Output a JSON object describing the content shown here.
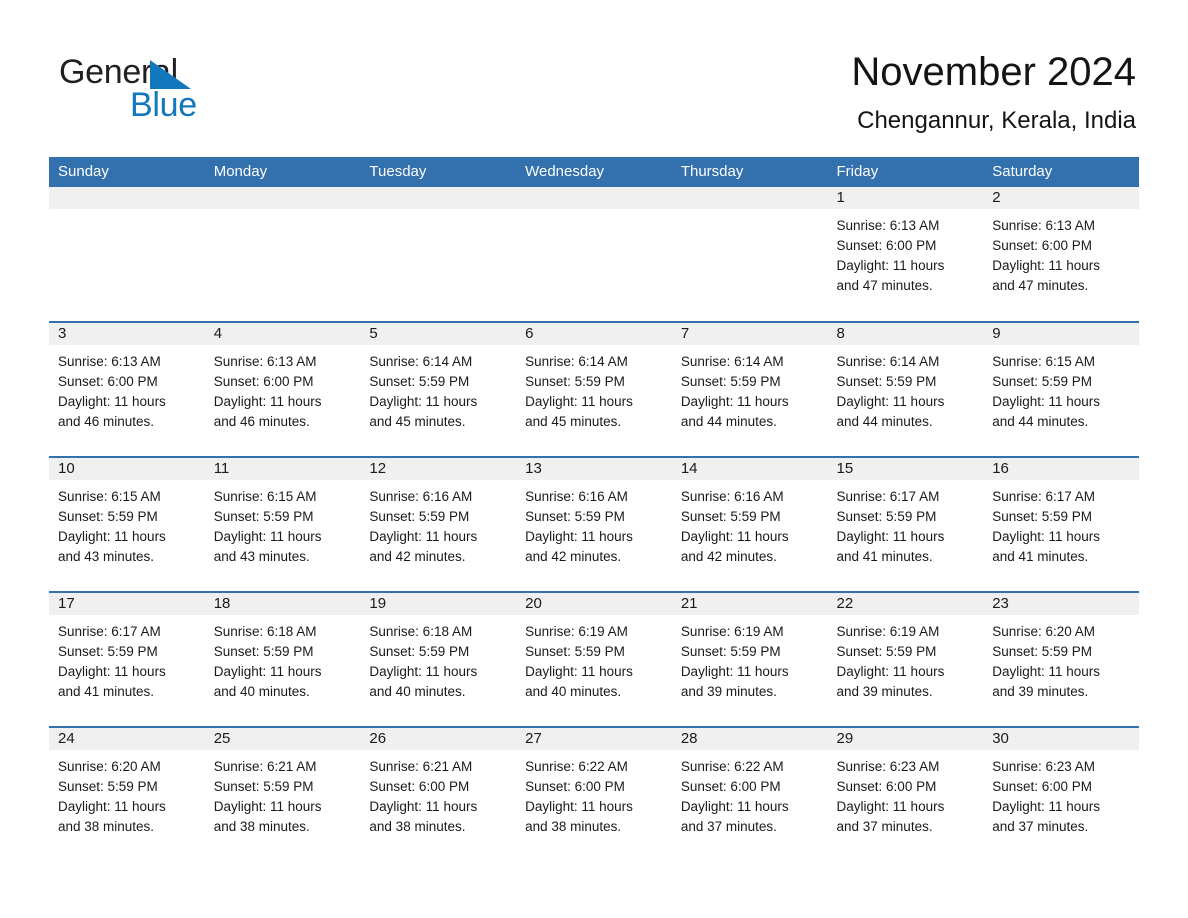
{
  "brand": {
    "name_part1": "General",
    "name_part2": "Blue",
    "triangle_color": "#1277bc",
    "text_color": "#231f20"
  },
  "header": {
    "month_title": "November 2024",
    "location": "Chengannur, Kerala, India"
  },
  "theme": {
    "header_blue": "#3270ae",
    "daynum_band": "#f0f0f0",
    "row_separator": "#3270ae",
    "text": "#1a1a1a"
  },
  "weekday_headers": [
    "Sunday",
    "Monday",
    "Tuesday",
    "Wednesday",
    "Thursday",
    "Friday",
    "Saturday"
  ],
  "labels": {
    "sunrise_prefix": "Sunrise: ",
    "sunset_prefix": "Sunset: ",
    "daylight_prefix": "Daylight: "
  },
  "weeks": [
    [
      {
        "empty": true
      },
      {
        "empty": true
      },
      {
        "empty": true
      },
      {
        "empty": true
      },
      {
        "empty": true
      },
      {
        "day": "1",
        "sunrise": "Sunrise: 6:13 AM",
        "sunset": "Sunset: 6:00 PM",
        "daylight_l1": "Daylight: 11 hours",
        "daylight_l2": "and 47 minutes."
      },
      {
        "day": "2",
        "sunrise": "Sunrise: 6:13 AM",
        "sunset": "Sunset: 6:00 PM",
        "daylight_l1": "Daylight: 11 hours",
        "daylight_l2": "and 47 minutes."
      }
    ],
    [
      {
        "day": "3",
        "sunrise": "Sunrise: 6:13 AM",
        "sunset": "Sunset: 6:00 PM",
        "daylight_l1": "Daylight: 11 hours",
        "daylight_l2": "and 46 minutes."
      },
      {
        "day": "4",
        "sunrise": "Sunrise: 6:13 AM",
        "sunset": "Sunset: 6:00 PM",
        "daylight_l1": "Daylight: 11 hours",
        "daylight_l2": "and 46 minutes."
      },
      {
        "day": "5",
        "sunrise": "Sunrise: 6:14 AM",
        "sunset": "Sunset: 5:59 PM",
        "daylight_l1": "Daylight: 11 hours",
        "daylight_l2": "and 45 minutes."
      },
      {
        "day": "6",
        "sunrise": "Sunrise: 6:14 AM",
        "sunset": "Sunset: 5:59 PM",
        "daylight_l1": "Daylight: 11 hours",
        "daylight_l2": "and 45 minutes."
      },
      {
        "day": "7",
        "sunrise": "Sunrise: 6:14 AM",
        "sunset": "Sunset: 5:59 PM",
        "daylight_l1": "Daylight: 11 hours",
        "daylight_l2": "and 44 minutes."
      },
      {
        "day": "8",
        "sunrise": "Sunrise: 6:14 AM",
        "sunset": "Sunset: 5:59 PM",
        "daylight_l1": "Daylight: 11 hours",
        "daylight_l2": "and 44 minutes."
      },
      {
        "day": "9",
        "sunrise": "Sunrise: 6:15 AM",
        "sunset": "Sunset: 5:59 PM",
        "daylight_l1": "Daylight: 11 hours",
        "daylight_l2": "and 44 minutes."
      }
    ],
    [
      {
        "day": "10",
        "sunrise": "Sunrise: 6:15 AM",
        "sunset": "Sunset: 5:59 PM",
        "daylight_l1": "Daylight: 11 hours",
        "daylight_l2": "and 43 minutes."
      },
      {
        "day": "11",
        "sunrise": "Sunrise: 6:15 AM",
        "sunset": "Sunset: 5:59 PM",
        "daylight_l1": "Daylight: 11 hours",
        "daylight_l2": "and 43 minutes."
      },
      {
        "day": "12",
        "sunrise": "Sunrise: 6:16 AM",
        "sunset": "Sunset: 5:59 PM",
        "daylight_l1": "Daylight: 11 hours",
        "daylight_l2": "and 42 minutes."
      },
      {
        "day": "13",
        "sunrise": "Sunrise: 6:16 AM",
        "sunset": "Sunset: 5:59 PM",
        "daylight_l1": "Daylight: 11 hours",
        "daylight_l2": "and 42 minutes."
      },
      {
        "day": "14",
        "sunrise": "Sunrise: 6:16 AM",
        "sunset": "Sunset: 5:59 PM",
        "daylight_l1": "Daylight: 11 hours",
        "daylight_l2": "and 42 minutes."
      },
      {
        "day": "15",
        "sunrise": "Sunrise: 6:17 AM",
        "sunset": "Sunset: 5:59 PM",
        "daylight_l1": "Daylight: 11 hours",
        "daylight_l2": "and 41 minutes."
      },
      {
        "day": "16",
        "sunrise": "Sunrise: 6:17 AM",
        "sunset": "Sunset: 5:59 PM",
        "daylight_l1": "Daylight: 11 hours",
        "daylight_l2": "and 41 minutes."
      }
    ],
    [
      {
        "day": "17",
        "sunrise": "Sunrise: 6:17 AM",
        "sunset": "Sunset: 5:59 PM",
        "daylight_l1": "Daylight: 11 hours",
        "daylight_l2": "and 41 minutes."
      },
      {
        "day": "18",
        "sunrise": "Sunrise: 6:18 AM",
        "sunset": "Sunset: 5:59 PM",
        "daylight_l1": "Daylight: 11 hours",
        "daylight_l2": "and 40 minutes."
      },
      {
        "day": "19",
        "sunrise": "Sunrise: 6:18 AM",
        "sunset": "Sunset: 5:59 PM",
        "daylight_l1": "Daylight: 11 hours",
        "daylight_l2": "and 40 minutes."
      },
      {
        "day": "20",
        "sunrise": "Sunrise: 6:19 AM",
        "sunset": "Sunset: 5:59 PM",
        "daylight_l1": "Daylight: 11 hours",
        "daylight_l2": "and 40 minutes."
      },
      {
        "day": "21",
        "sunrise": "Sunrise: 6:19 AM",
        "sunset": "Sunset: 5:59 PM",
        "daylight_l1": "Daylight: 11 hours",
        "daylight_l2": "and 39 minutes."
      },
      {
        "day": "22",
        "sunrise": "Sunrise: 6:19 AM",
        "sunset": "Sunset: 5:59 PM",
        "daylight_l1": "Daylight: 11 hours",
        "daylight_l2": "and 39 minutes."
      },
      {
        "day": "23",
        "sunrise": "Sunrise: 6:20 AM",
        "sunset": "Sunset: 5:59 PM",
        "daylight_l1": "Daylight: 11 hours",
        "daylight_l2": "and 39 minutes."
      }
    ],
    [
      {
        "day": "24",
        "sunrise": "Sunrise: 6:20 AM",
        "sunset": "Sunset: 5:59 PM",
        "daylight_l1": "Daylight: 11 hours",
        "daylight_l2": "and 38 minutes."
      },
      {
        "day": "25",
        "sunrise": "Sunrise: 6:21 AM",
        "sunset": "Sunset: 5:59 PM",
        "daylight_l1": "Daylight: 11 hours",
        "daylight_l2": "and 38 minutes."
      },
      {
        "day": "26",
        "sunrise": "Sunrise: 6:21 AM",
        "sunset": "Sunset: 6:00 PM",
        "daylight_l1": "Daylight: 11 hours",
        "daylight_l2": "and 38 minutes."
      },
      {
        "day": "27",
        "sunrise": "Sunrise: 6:22 AM",
        "sunset": "Sunset: 6:00 PM",
        "daylight_l1": "Daylight: 11 hours",
        "daylight_l2": "and 38 minutes."
      },
      {
        "day": "28",
        "sunrise": "Sunrise: 6:22 AM",
        "sunset": "Sunset: 6:00 PM",
        "daylight_l1": "Daylight: 11 hours",
        "daylight_l2": "and 37 minutes."
      },
      {
        "day": "29",
        "sunrise": "Sunrise: 6:23 AM",
        "sunset": "Sunset: 6:00 PM",
        "daylight_l1": "Daylight: 11 hours",
        "daylight_l2": "and 37 minutes."
      },
      {
        "day": "30",
        "sunrise": "Sunrise: 6:23 AM",
        "sunset": "Sunset: 6:00 PM",
        "daylight_l1": "Daylight: 11 hours",
        "daylight_l2": "and 37 minutes."
      }
    ]
  ]
}
